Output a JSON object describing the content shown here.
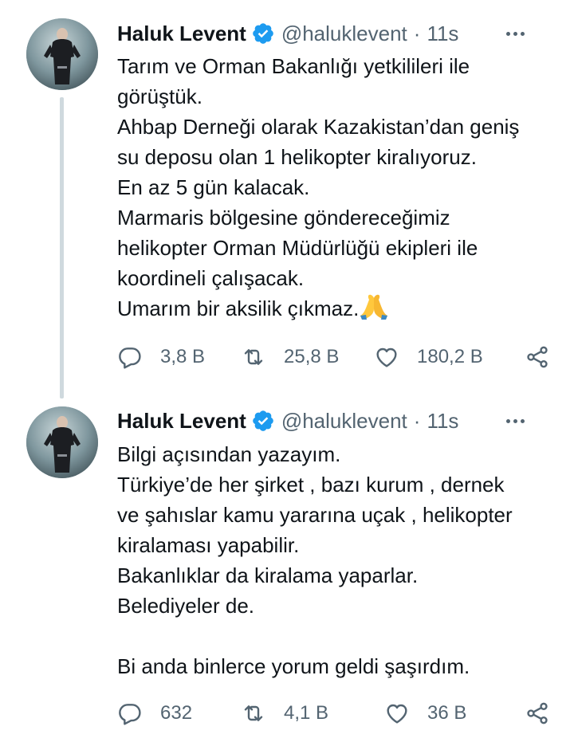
{
  "tweets": [
    {
      "author": {
        "name": "Haluk Levent",
        "handle": "@haluklevent",
        "avatar_icon": "person-avatar",
        "verified_icon": "verified-badge-icon"
      },
      "separator": "·",
      "time": "11s",
      "text": "Tarım ve Orman Bakanlığı yetkilileri ile\ngörüştük.\nAhbap Derneği olarak Kazakistan’dan geniş\nsu deposu olan 1 helikopter kiralıyoruz.\nEn az 5 gün kalacak.\nMarmaris bölgesine göndereceğimiz\nhelikopter Orman Müdürlüğü ekipleri ile\nkoordineli çalışacak.\nUmarım bir aksilik çıkmaz.",
      "trailing_emoji": "🙏",
      "stats": {
        "replies": "3,8 B",
        "retweets": "25,8 B",
        "likes": "180,2 B"
      }
    },
    {
      "author": {
        "name": "Haluk Levent",
        "handle": "@haluklevent",
        "avatar_icon": "person-avatar",
        "verified_icon": "verified-badge-icon"
      },
      "separator": "·",
      "time": "11s",
      "text": "Bilgi açısından yazayım.\nTürkiye’de her şirket , bazı kurum , dernek\nve şahıslar kamu yararına uçak , helikopter\nkiralaması yapabilir.\nBakanlıklar da kiralama yaparlar.\nBelediyeler de.\n\nBi anda binlerce yorum geldi şaşırdım.",
      "stats": {
        "replies": "632",
        "retweets": "4,1 B",
        "likes": "36 B"
      }
    }
  ],
  "colors": {
    "verified": "#1d9bf0",
    "secondary_text": "#536471",
    "thread_line": "#cfd9de",
    "primary_text": "#0f1419"
  }
}
